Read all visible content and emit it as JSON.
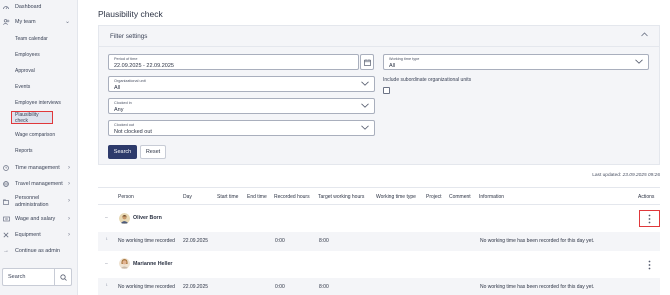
{
  "sidebar": {
    "items": [
      {
        "label": "Dashboard",
        "icon": "dashboard-icon"
      },
      {
        "label": "My team",
        "icon": "team-icon"
      },
      {
        "label": "Time management",
        "icon": "clock-icon"
      },
      {
        "label": "Travel management",
        "icon": "globe-icon"
      },
      {
        "label": "Personnel",
        "label2": "administration",
        "icon": "folder-icon"
      },
      {
        "label": "Wage and salary",
        "icon": "money-icon"
      },
      {
        "label": "Equipment",
        "icon": "tools-icon"
      },
      {
        "label": "Continue as admin",
        "icon": "arrow-right-icon"
      }
    ],
    "subitems": [
      "Team calendar",
      "Employees",
      "Approval",
      "Events",
      "Employee interviews",
      "Plausibility check",
      "Wage comparison",
      "Reports"
    ],
    "active_subitem": "Plausibility check",
    "search_label": "Search"
  },
  "page": {
    "title": "Plausibility check"
  },
  "filter": {
    "heading": "Filter settings",
    "period": {
      "label": "Period of time",
      "value": "22.09.2025 - 22.09.2025"
    },
    "working_time_type": {
      "label": "Working time type",
      "value": "All"
    },
    "org_unit": {
      "label": "Organizational unit",
      "value": "All"
    },
    "include_subordinate": {
      "label": "Include subordinate organizational units",
      "checked": false
    },
    "clocked_in": {
      "label": "Clocked in",
      "value": "Any"
    },
    "clocked_out": {
      "label": "Clocked out",
      "value": "Not clocked out"
    },
    "search_button": "Search",
    "reset_button": "Reset"
  },
  "last_updated": {
    "label": "Last updated:",
    "value": "23.09.2025 09:26"
  },
  "table": {
    "columns": [
      "Person",
      "Day",
      "Start time",
      "End time",
      "Recorded hours",
      "Target working hours",
      "Working time type",
      "Project",
      "Comment",
      "Information",
      "Actions"
    ],
    "rows": [
      {
        "person": "Oliver Born",
        "detail": {
          "person": "No working time recorded",
          "day": "22.09.2025",
          "recorded_hours": "0:00",
          "target_hours": "8:00",
          "information": "No working time has been recorded for this day yet."
        }
      },
      {
        "person": "Marianne Heller",
        "detail": {
          "person": "No working time recorded",
          "day": "22.09.2025",
          "recorded_hours": "0:00",
          "target_hours": "8:00",
          "information": "No working time has been recorded for this day yet."
        }
      }
    ]
  },
  "colors": {
    "accent": "#2d3a6b",
    "highlight": "#e0383b",
    "sidebar_bg": "#f3f4f7"
  }
}
